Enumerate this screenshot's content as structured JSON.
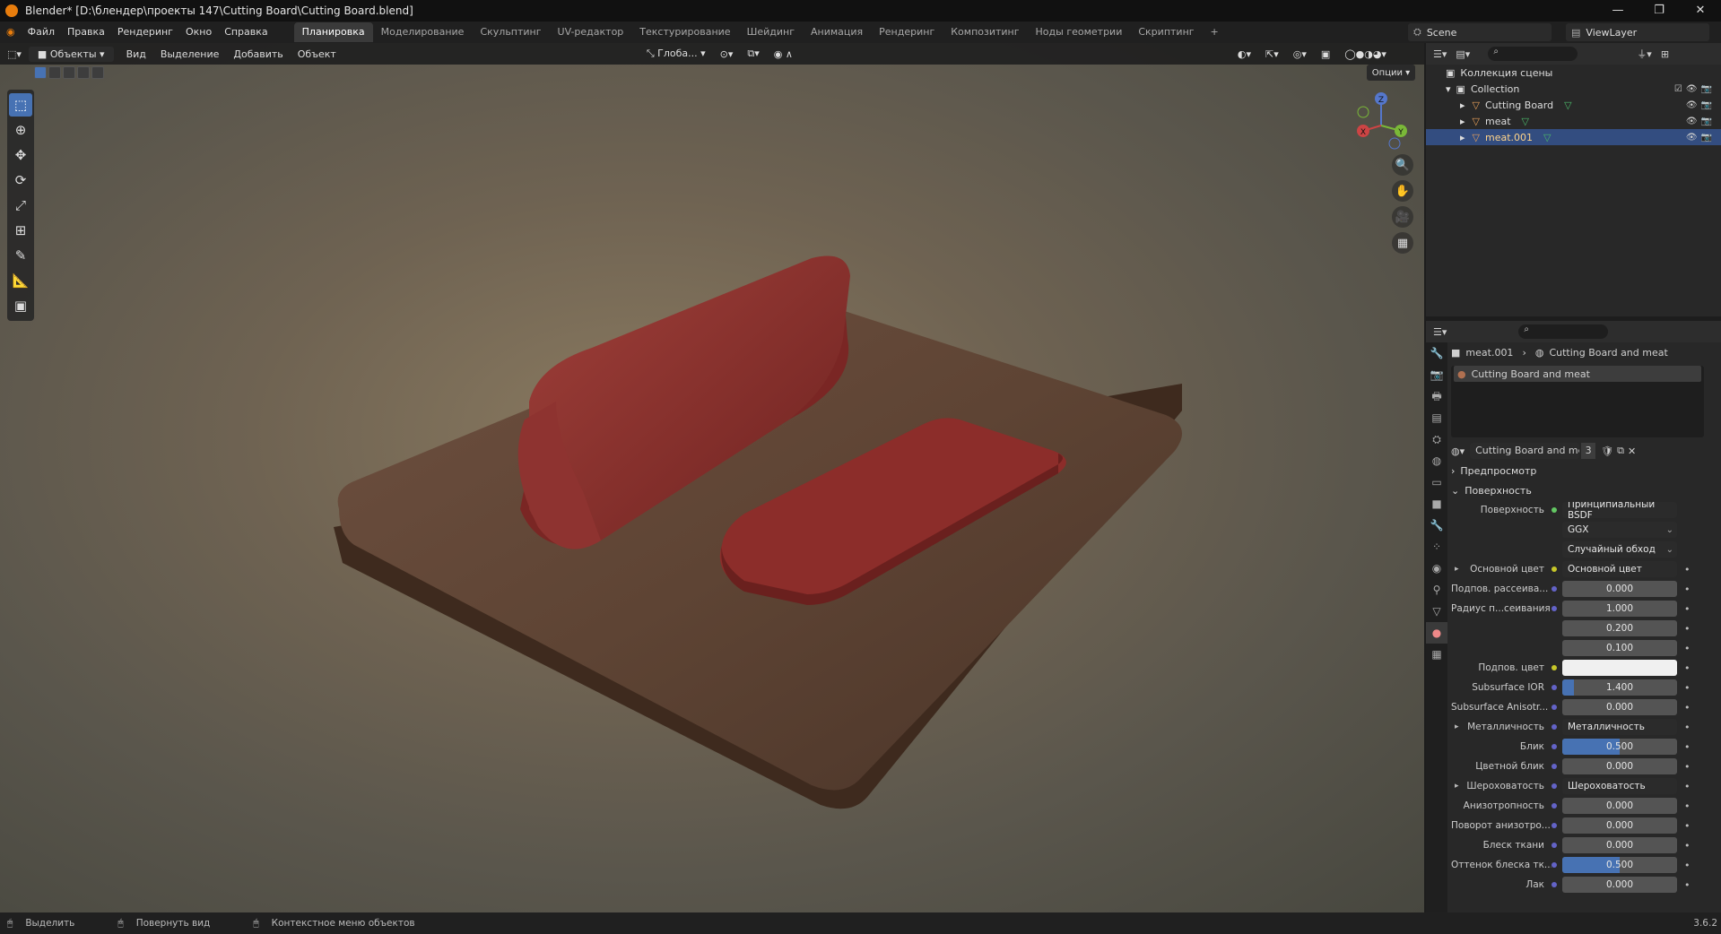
{
  "window": {
    "title": "Blender* [D:\\блендер\\проекты 147\\Cutting Board\\Cutting Board.blend]",
    "controls": [
      "—",
      "❐",
      "✕"
    ]
  },
  "menu": [
    "Файл",
    "Правка",
    "Рендеринг",
    "Окно",
    "Справка"
  ],
  "workspace_tabs": [
    {
      "label": "Планировка",
      "active": true
    },
    {
      "label": "Моделирование",
      "active": false
    },
    {
      "label": "Скульптинг",
      "active": false
    },
    {
      "label": "UV-редактор",
      "active": false
    },
    {
      "label": "Текстурирование",
      "active": false
    },
    {
      "label": "Шейдинг",
      "active": false
    },
    {
      "label": "Анимация",
      "active": false
    },
    {
      "label": "Рендеринг",
      "active": false
    },
    {
      "label": "Композитинг",
      "active": false
    },
    {
      "label": "Ноды геометрии",
      "active": false
    },
    {
      "label": "Скриптинг",
      "active": false
    },
    {
      "label": "+",
      "active": false
    }
  ],
  "scene": {
    "name": "Scene",
    "view_layer": "ViewLayer"
  },
  "viewport_header": {
    "mode": "Объекты",
    "items": [
      "Вид",
      "Выделение",
      "Добавить",
      "Объект"
    ],
    "transform_orientation": "Глоба...",
    "options": "Опции"
  },
  "gizmo": {
    "x": "X",
    "y": "Y",
    "z": "Z"
  },
  "outliner": {
    "root": "Коллекция сцены",
    "collection": "Collection",
    "objects": [
      {
        "name": "Cutting Board",
        "selected": false
      },
      {
        "name": "meat",
        "selected": false
      },
      {
        "name": "meat.001",
        "selected": true
      }
    ]
  },
  "properties": {
    "breadcrumb_object": "meat.001",
    "breadcrumb_material": "Cutting Board and meat",
    "slot_name": "Cutting Board and meat",
    "material_name": "Cutting Board and meat",
    "user_count": "3",
    "section_preview": "Предпросмотр",
    "section_surface": "Поверхность",
    "surface_label": "Поверхность",
    "surface_value": "Принципиальный BSDF",
    "distribution": "GGX",
    "subsurface_method": "Случайный обход",
    "rows": [
      {
        "label": "Основной цвет",
        "value": "Основной цвет",
        "kind": "socket",
        "dot": "y",
        "expand": true
      },
      {
        "label": "Подпов. рассеива...",
        "value": "0.000",
        "kind": "num",
        "fill": 0,
        "dot": "b"
      },
      {
        "label": "Радиус п...сеивания",
        "value": "1.000",
        "kind": "num",
        "fill": 0,
        "dot": "b"
      },
      {
        "label": "",
        "value": "0.200",
        "kind": "num",
        "fill": 0,
        "dot": ""
      },
      {
        "label": "",
        "value": "0.100",
        "kind": "num",
        "fill": 0,
        "dot": ""
      },
      {
        "label": "Подпов. цвет",
        "value": "",
        "kind": "color",
        "dot": "y"
      },
      {
        "label": "Subsurface IOR",
        "value": "1.400",
        "kind": "num",
        "fill": 0.1,
        "dot": "b"
      },
      {
        "label": "Subsurface Anisotr...",
        "value": "0.000",
        "kind": "num",
        "fill": 0,
        "dot": "b"
      },
      {
        "label": "Металличность",
        "value": "Металличность",
        "kind": "socket",
        "dot": "b",
        "expand": true
      },
      {
        "label": "Блик",
        "value": "0.500",
        "kind": "num",
        "fill": 0.5,
        "dot": "b"
      },
      {
        "label": "Цветной блик",
        "value": "0.000",
        "kind": "num",
        "fill": 0,
        "dot": "b"
      },
      {
        "label": "Шероховатость",
        "value": "Шероховатость",
        "kind": "socket",
        "dot": "b",
        "expand": true
      },
      {
        "label": "Анизотропность",
        "value": "0.000",
        "kind": "num",
        "fill": 0,
        "dot": "b"
      },
      {
        "label": "Поворот анизотро...",
        "value": "0.000",
        "kind": "num",
        "fill": 0,
        "dot": "b"
      },
      {
        "label": "Блеск ткани",
        "value": "0.000",
        "kind": "num",
        "fill": 0,
        "dot": "b"
      },
      {
        "label": "Оттенок блеска тк...",
        "value": "0.500",
        "kind": "num",
        "fill": 0.5,
        "dot": "b"
      },
      {
        "label": "Лак",
        "value": "0.000",
        "kind": "num",
        "fill": 0,
        "dot": "b"
      }
    ]
  },
  "statusbar": {
    "select": "Выделить",
    "rotate": "Повернуть вид",
    "context": "Контекстное меню объектов",
    "version": "3.6.2"
  },
  "colors": {
    "accent": "#4772b3",
    "selected_row": "#334d80",
    "meat": "#8c2d2a",
    "wood": "#6b4a36"
  }
}
